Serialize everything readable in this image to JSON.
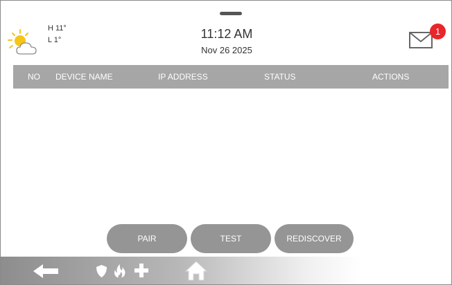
{
  "header": {
    "weather": {
      "icon": "partly-cloudy-icon",
      "high": "H 11°",
      "low": "L 1°"
    },
    "time": "11:12 AM",
    "date": "Nov 26 2025",
    "messages": {
      "icon": "envelope-icon",
      "count": "1"
    }
  },
  "table": {
    "columns": [
      "NO",
      "DEVICE NAME",
      "IP ADDRESS",
      "STATUS",
      "ACTIONS"
    ],
    "rows": []
  },
  "buttons": {
    "pair": "PAIR",
    "test": "TEST",
    "rediscover": "REDISCOVER"
  },
  "nav": [
    "back-arrow-icon",
    "shield-icon",
    "flame-icon",
    "cross-icon",
    "home-icon"
  ],
  "colors": {
    "header_bar": "#a6a6a6",
    "button": "#959595",
    "badge": "#e8262c",
    "sun": "#f5c518"
  }
}
